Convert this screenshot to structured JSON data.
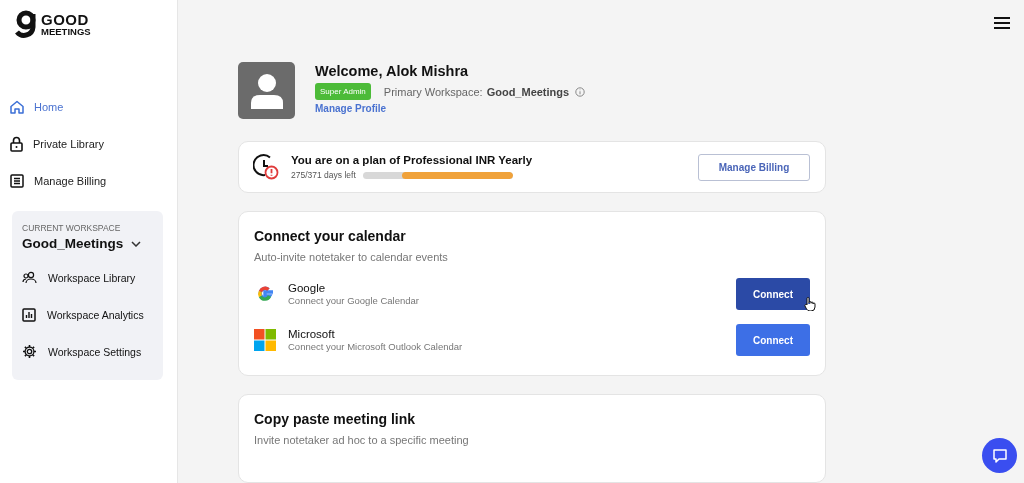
{
  "logo": {
    "line_1": "GOOD",
    "line_2": "MEETINGS"
  },
  "sidebar": {
    "items": [
      {
        "label": "Home",
        "kind": "home",
        "selected": true
      },
      {
        "label": "Private Library",
        "kind": "lock",
        "selected": false
      },
      {
        "label": "Manage Billing",
        "kind": "billing",
        "selected": false
      }
    ],
    "workspace": {
      "caption": "CURRENT WORKSPACE",
      "name": "Good_Meetings",
      "items": [
        {
          "label": "Workspace Library",
          "kind": "people"
        },
        {
          "label": "Workspace Analytics",
          "kind": "chart"
        },
        {
          "label": "Workspace Settings",
          "kind": "gear"
        }
      ]
    }
  },
  "profile": {
    "welcome": "Welcome, Alok Mishra",
    "role_badge": "Super Admin",
    "workspace_label": "Primary Workspace:",
    "workspace_name": "Good_Meetings",
    "link": "Manage Profile"
  },
  "plan": {
    "title": "You are on a plan of Professional INR Yearly",
    "days_left": "275/371 days left",
    "level": 0.74,
    "button": "Manage Billing"
  },
  "calendar": {
    "title": "Connect your calendar",
    "subtitle": "Auto-invite notetaker to calendar events",
    "providers": [
      {
        "kind": "google",
        "name": "Google",
        "description": "Connect your Google Calendar",
        "button": "Connect",
        "hovered": true
      },
      {
        "kind": "microsoft",
        "name": "Microsoft",
        "description": "Connect your Microsoft Outlook Calendar",
        "button": "Connect",
        "hovered": false
      }
    ]
  },
  "meeting_link": {
    "title": "Copy paste meeting link",
    "subtitle": "Invite notetaker ad hoc to a specific meeting"
  }
}
